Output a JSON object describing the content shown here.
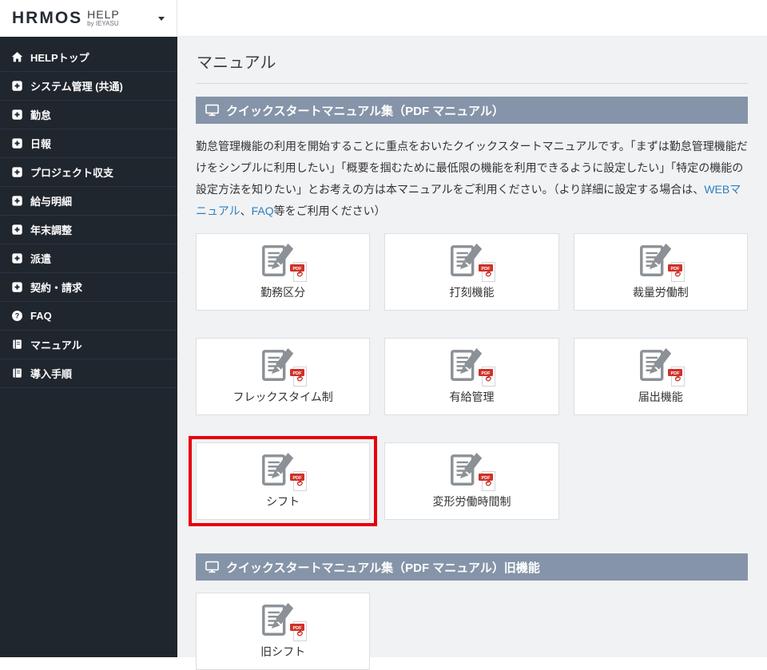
{
  "logo": {
    "brand": "HRMOS",
    "product": "HELP",
    "byline": "by IEYASU"
  },
  "sidebar": {
    "items": [
      {
        "icon": "home-icon",
        "label": "HELPトップ"
      },
      {
        "icon": "plus-square-icon",
        "label": "システム管理 (共通)"
      },
      {
        "icon": "plus-square-icon",
        "label": "勤怠"
      },
      {
        "icon": "plus-square-icon",
        "label": "日報"
      },
      {
        "icon": "plus-square-icon",
        "label": "プロジェクト収支"
      },
      {
        "icon": "plus-square-icon",
        "label": "給与明細"
      },
      {
        "icon": "plus-square-icon",
        "label": "年末調整"
      },
      {
        "icon": "plus-square-icon",
        "label": "派遣"
      },
      {
        "icon": "plus-square-icon",
        "label": "契約・請求"
      },
      {
        "icon": "question-circle-icon",
        "label": "FAQ"
      },
      {
        "icon": "book-icon",
        "label": "マニュアル"
      },
      {
        "icon": "book-icon",
        "label": "導入手順"
      }
    ]
  },
  "page": {
    "title": "マニュアル"
  },
  "sections": [
    {
      "header": "クイックスタートマニュアル集（PDF マニュアル）",
      "description": {
        "p1": "勤怠管理機能の利用を開始することに重点をおいたクイックスタートマニュアルです。「まずは勤怠管理機能だけをシンプルに利用したい」「概要を掴むために最低限の機能を利用できるように設定したい」「特定の機能の設定方法を知りたい」とお考えの方は本マニュアルをご利用ください。（より詳細に設定する場合は、",
        "link1": "WEBマニュアル",
        "sep": "、",
        "link2": "FAQ",
        "p3": "等をご利用ください）"
      },
      "cards": [
        {
          "label": "勤務区分"
        },
        {
          "label": "打刻機能"
        },
        {
          "label": "裁量労働制"
        },
        {
          "label": "フレックスタイム制"
        },
        {
          "label": "有給管理"
        },
        {
          "label": "届出機能"
        },
        {
          "label": "シフト",
          "highlighted": true
        },
        {
          "label": "変形労働時間制"
        }
      ]
    },
    {
      "header": "クイックスタートマニュアル集（PDF マニュアル）旧機能",
      "cards": [
        {
          "label": "旧シフト"
        }
      ]
    }
  ],
  "pdf_badge": {
    "label": "PDF"
  },
  "icons": {
    "question_glyph": "?"
  },
  "colors": {
    "sidebar_bg": "#20262e",
    "section_header_bg": "#8594a8",
    "link": "#2e7fbe",
    "highlight_red": "#e8000d",
    "pdf_red": "#cf3028",
    "icon_gray": "#8b9196"
  }
}
